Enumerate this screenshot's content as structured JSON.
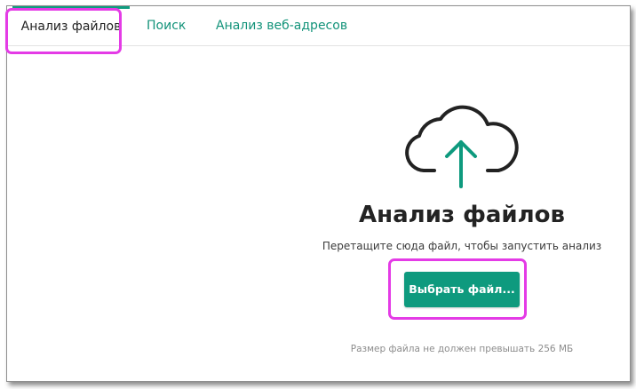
{
  "tabs": [
    {
      "label": "Анализ файлов",
      "active": true
    },
    {
      "label": "Поиск",
      "active": false
    },
    {
      "label": "Анализ веб-адресов",
      "active": false
    }
  ],
  "upload": {
    "icon": "cloud-upload-icon",
    "title": "Анализ файлов",
    "hint": "Перетащите сюда файл, чтобы запустить анализ",
    "button_label": "Выбрать файл...",
    "size_limit": "Размер файла не должен превышать 256 МБ"
  },
  "colors": {
    "accent": "#0e9a7e",
    "highlight": "#e43be6",
    "text_dark": "#232323",
    "text_muted": "#8c8c8c"
  }
}
